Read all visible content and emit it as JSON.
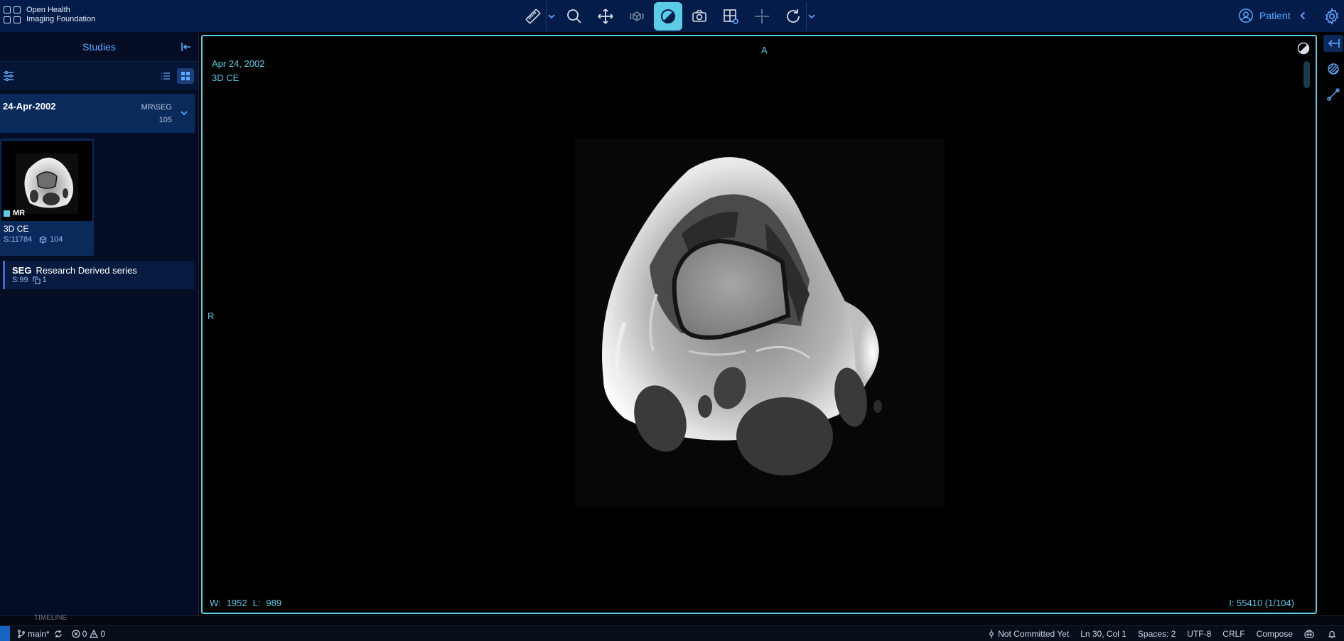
{
  "app": {
    "logo_line1": "Open Health",
    "logo_line2": "Imaging Foundation",
    "patient_label": "Patient"
  },
  "toolbar": {
    "tools": [
      "ruler-icon",
      "zoom-icon",
      "pan-icon",
      "rotate-3d-icon",
      "window-level-icon",
      "camera-icon",
      "layout-icon",
      "crosshair-icon",
      "reset-icon"
    ],
    "active_tool": "window-level-icon"
  },
  "studies_panel": {
    "title": "Studies",
    "study": {
      "date": "24-Apr-2002",
      "modalities": "MR\\SEG",
      "count": "105"
    },
    "series": {
      "modality": "MR",
      "description": "3D CE",
      "series_number": "S:11784",
      "instances": "104"
    },
    "seg": {
      "modality": "SEG",
      "description": "Research Derived series",
      "series_number": "S:99",
      "instances": "1"
    }
  },
  "viewport": {
    "orientation_top": "A",
    "orientation_left": "R",
    "study_date": "Apr 24, 2002",
    "series_desc": "3D CE",
    "window_label": "W:",
    "window_value": "1952",
    "level_label": "L:",
    "level_value": "989",
    "instance": "I: 55410 (1/104)"
  },
  "statusbar": {
    "timeline": "TIMELINE",
    "branch": "main*",
    "errors": "0",
    "warnings": "0",
    "blame": "Not Committed Yet",
    "cursor": "Ln 30, Col 1",
    "spaces": "Spaces: 2",
    "encoding": "UTF-8",
    "eol": "CRLF",
    "language": "Compose"
  },
  "colors": {
    "accent": "#5acce6",
    "topbar": "#041c4a",
    "link": "#5ea9ff",
    "panel": "#040d24"
  }
}
